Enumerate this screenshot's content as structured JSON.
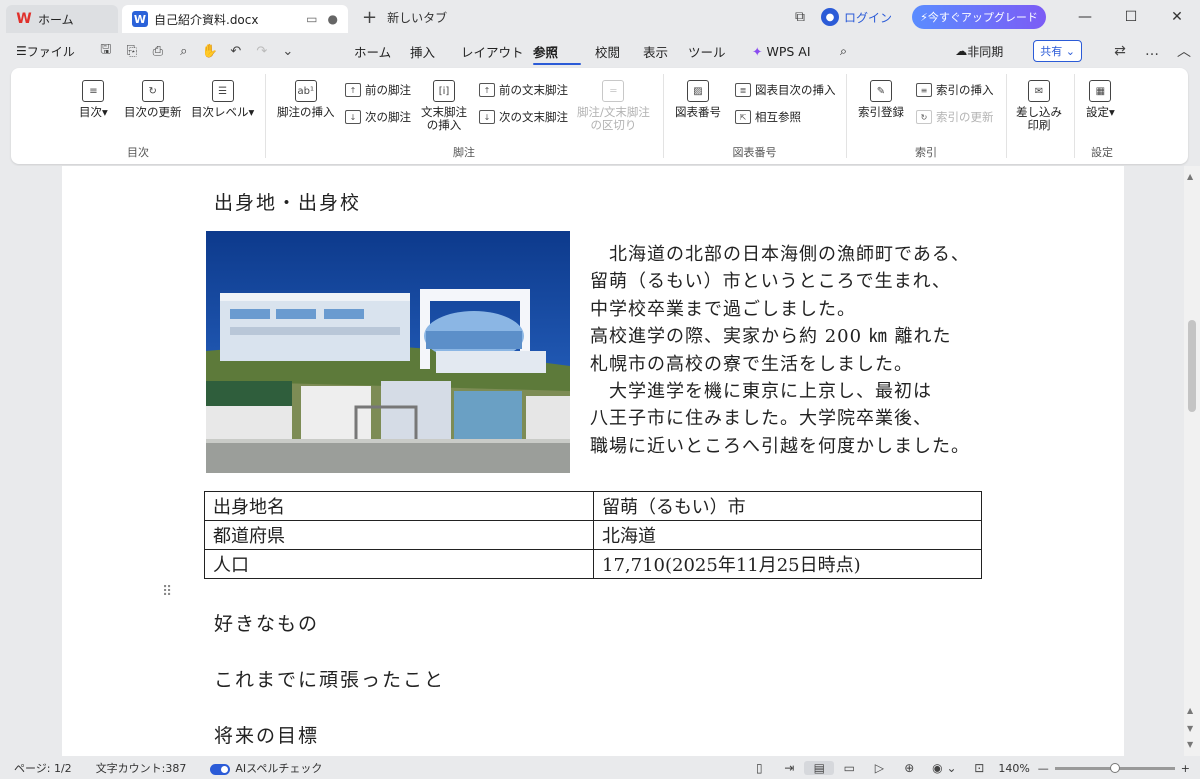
{
  "titlebar": {
    "home_tab": "ホーム",
    "doc_tab": "自己紹介資料.docx",
    "new_tab": "新しいタブ",
    "login": "ログイン",
    "upgrade": "今すぐアップグレード"
  },
  "menubar": {
    "file": "ファイル",
    "tabs": [
      "ホーム",
      "挿入",
      "レイアウト",
      "参照",
      "校閲",
      "表示",
      "ツール",
      "WPS AI"
    ],
    "active_tab": "参照",
    "sync": "非同期",
    "share": "共有"
  },
  "ribbon": {
    "toc": {
      "label": "目次",
      "buttons": [
        "目次",
        "目次の更新",
        "目次レベル"
      ]
    },
    "footnote": {
      "label": "脚注",
      "insert": "脚注の挿入",
      "prev": "前の脚注",
      "next": "次の脚注",
      "endnote_insert_1": "文末脚注",
      "endnote_insert_2": "の挿入",
      "prev_end": "前の文末脚注",
      "next_end": "次の文末脚注",
      "separator_1": "脚注/文末脚注",
      "separator_2": "の区切り"
    },
    "caption": {
      "label": "図表番号",
      "caption": "図表番号",
      "insert_table": "図表目次の挿入",
      "cross_ref": "相互参照"
    },
    "index": {
      "label": "索引",
      "mark": "索引登録",
      "insert": "索引の挿入",
      "update": "索引の更新"
    },
    "mail": {
      "line1": "差し込み",
      "line2": "印刷"
    },
    "settings": {
      "label": "設定",
      "button": "設定"
    }
  },
  "document": {
    "heading1": "出身地・出身校",
    "photo_alt": "留萌の風景写真",
    "body_lines": [
      "　北海道の北部の日本海側の漁師町である、",
      "留萌（るもい）市というところで生まれ、",
      "中学校卒業まで過ごしました。",
      "高校進学の際、実家から約 200 ㎞ 離れた",
      "札幌市の高校の寮で生活をしました。",
      "　大学進学を機に東京に上京し、最初は",
      "八王子市に住みました。大学院卒業後、",
      "職場に近いところへ引越を何度かしました。"
    ],
    "table": [
      [
        "出身地名",
        "留萌（るもい）市"
      ],
      [
        "都道府県",
        "北海道"
      ],
      [
        "人口",
        "17,710(2025年11月25日時点)"
      ]
    ],
    "heading2": "好きなもの",
    "heading3": "これまでに頑張ったこと",
    "heading4": "将来の目標"
  },
  "statusbar": {
    "page": "ページ: 1/2",
    "wordcount": "文字カウント:387",
    "spellcheck": "AIスペルチェック",
    "zoom": "140%",
    "zoom_fraction": 0.5
  },
  "colors": {
    "accent": "#2b5bd7",
    "upgrade_start": "#5a8cff",
    "upgrade_end": "#7c5cf5"
  }
}
